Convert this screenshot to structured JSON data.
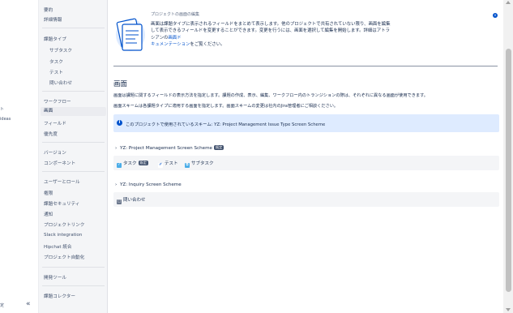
{
  "global_rail": {
    "item1": "ト",
    "item2": "ideas",
    "item3": "定",
    "collapse": "«"
  },
  "sidebar": {
    "items": {
      "summary": "要約",
      "details": "詳細情報",
      "issue_types": "課題タイプ",
      "subtask": "サブタスク",
      "task": "タスク",
      "test": "テスト",
      "inquiry": "問い合わせ",
      "workflows": "ワークフロー",
      "screens": "画面",
      "fields": "フィールド",
      "priorities": "優先度",
      "versions": "バージョン",
      "components": "コンポーネント",
      "users_roles": "ユーザーとロール",
      "permissions": "権限",
      "issue_security": "課題セキュリティ",
      "notifications": "通知",
      "project_links": "プロジェクトリンク",
      "slack": "Slack integration",
      "hipchat": "Hipchat 統合",
      "automation": "プロジェクト自動化",
      "dev_tools": "開発ツール",
      "issue_collectors": "課題コレクター"
    }
  },
  "banner": {
    "title": "プロジェクトの画面の編集",
    "line1": "画面は課題タイプに表示されるフィールドをまとめて表示します。他のプロジェクトで共有されていない限り、画面を編集して表示",
    "line2": "できるフィールドを変更することができます。変更を行うには、画面を選択して編集を開始します。詳細はアトラシアンの",
    "link": "画面ド",
    "line3": "キュメンテーション",
    "line3_tail": "をご覧ください。",
    "close": "×"
  },
  "main": {
    "heading": "画面",
    "desc1": "画面は課題に関するフィールドの表示方法を指定します。課題の作成、表示、編集、ワークフロー内のトランジションの際は、それぞれに異なる画面が使用できます。",
    "desc2": "画面スキームは各課題タイプに適用する画面を指定します。画面スキームの変更は社内のJira管理者にご相談ください。",
    "notice_icon": "i",
    "notice": "このプロジェクトで使用されているスキーム: YZ: Project Management Issue Type Screen Scheme",
    "scheme1": {
      "name": "YZ: Project Management Screen Scheme",
      "badge": "既定",
      "types": [
        "タスク",
        "テスト",
        "サブタスク"
      ],
      "task_badge": "既定"
    },
    "scheme2": {
      "name": "YZ: Inquiry Screen Scheme",
      "types": [
        "問い合わせ"
      ]
    }
  },
  "colors": {
    "accent": "#0052cc",
    "sidebar_bg": "#f4f5f7",
    "notice_bg": "#deebff"
  }
}
